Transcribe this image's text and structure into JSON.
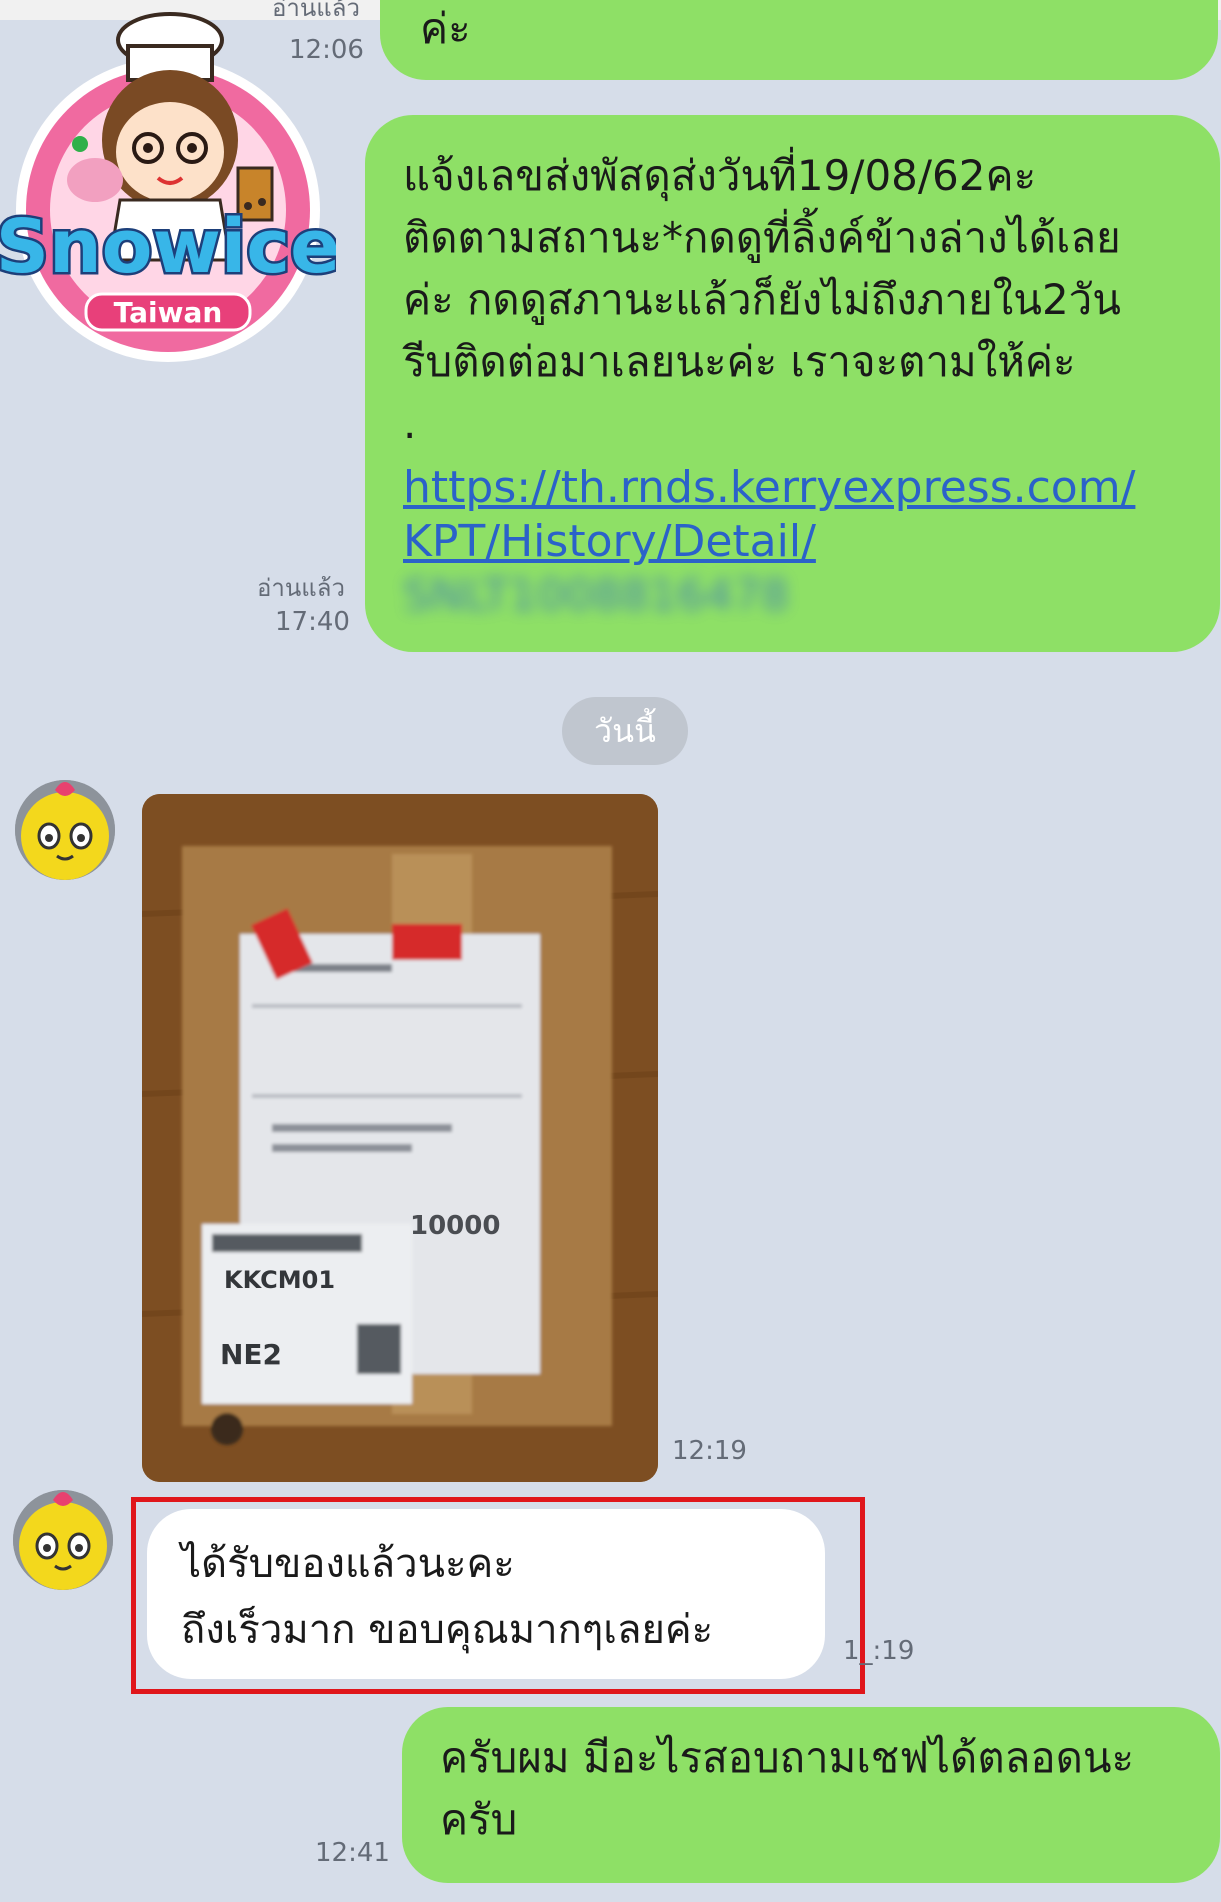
{
  "colors": {
    "background": "#d6dde9",
    "outgoing_bubble": "#8ee066",
    "incoming_bubble": "#ffffff",
    "link": "#2b62c9",
    "highlight_border": "#e0161b"
  },
  "logo": {
    "brand": "Snowice",
    "sub": "Taiwan"
  },
  "messages": {
    "m1": {
      "read": "อ่านแล้ว",
      "time": "12:06",
      "text": "ค่ะ"
    },
    "m2": {
      "read": "อ่านแล้ว",
      "time": "17:40",
      "text": "แจ้งเลขส่งพัสดุส่งวันที่19/08/62คะ\nติดตามสถานะ*กดดูที่ลิ้งค์ข้างล่างได้เลย\nค่ะ กดดูสภานะแล้วก็ยังไม่ถึงภายใน2วัน\nรีบติดต่อมาเลยนะค่ะ เราจะตามให้ค่ะ\n.",
      "link_line1": "https://th.rnds.kerryexpress.com/",
      "link_line2": "KPT/History/Detail/",
      "link_line3": "SNLT1008816478"
    },
    "date_separator": "วันนี้",
    "m3": {
      "time": "12:19",
      "photo_label_1": "10000",
      "photo_label_2": "KKCM01",
      "photo_label_3": "NE2"
    },
    "m4": {
      "time": "1_:19",
      "text": "ได้รับของแล้วนะคะ\nถึงเร็วมาก ขอบคุณมากๆเลยค่ะ"
    },
    "m5": {
      "time": "12:41",
      "text": "ครับผม มีอะไรสอบถามเชฟได้ตลอดนะ\nครับ"
    }
  }
}
